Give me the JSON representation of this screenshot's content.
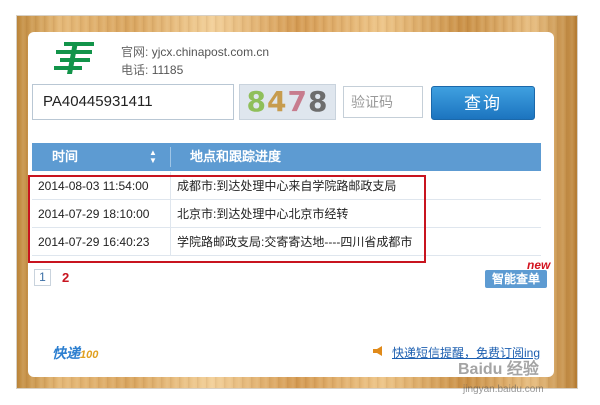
{
  "header": {
    "site_label": "官网:",
    "site_value": "yjcx.chinapost.com.cn",
    "phone_label": "电话:",
    "phone_value": "11185"
  },
  "search": {
    "tracking_number": "PA40445931411",
    "captcha_digits": [
      "8",
      "4",
      "7",
      "8"
    ],
    "verify_placeholder": "验证码",
    "query_label": "查询"
  },
  "table": {
    "col_time": "时间",
    "col_location": "地点和跟踪进度",
    "rows": [
      {
        "time": "2014-08-03 11:54:00",
        "location": "成都市:到达处理中心来自学院路邮政支局"
      },
      {
        "time": "2014-07-29 18:10:00",
        "location": "北京市:到达处理中心北京市经转"
      },
      {
        "time": "2014-07-29 16:40:23",
        "location": "学院路邮政支局:交寄寄达地----四川省成都市"
      }
    ]
  },
  "pager": {
    "page1": "1",
    "page2": "2"
  },
  "smart": {
    "label": "智能查单",
    "badge": "new"
  },
  "footer": {
    "logo_main": "快递",
    "logo_sub": "100",
    "sms_link": "快递短信提醒，免费订阅ing"
  },
  "watermark": {
    "text": "Baidu 经验",
    "url": "jingyan.baidu.com"
  },
  "colors": {
    "accent": "#5d9bd2",
    "highlight": "#c8141f",
    "button": "#1c74bf"
  }
}
